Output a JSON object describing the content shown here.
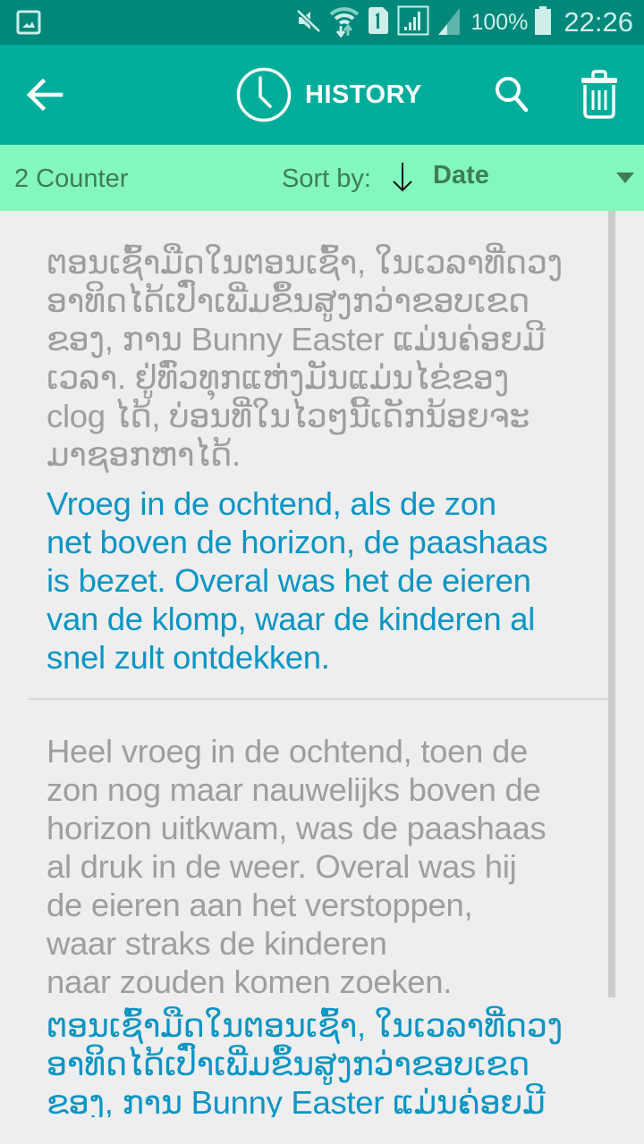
{
  "status_bar": {
    "left_icon": "gallery-notification-icon",
    "icons": [
      "mute-icon",
      "wifi-data-icon",
      "sim1-icon",
      "signal-sim1-icon",
      "signal-sim2-icon",
      "battery-icon"
    ],
    "battery_percent": "100%",
    "time": "22:26"
  },
  "app_bar": {
    "back_icon": "arrow-left-icon",
    "title_icon": "clock-icon",
    "title": "HISTORY",
    "search_icon": "search-icon",
    "delete_icon": "trash-icon",
    "background_color": "#00ad9b"
  },
  "sort_bar": {
    "counter": "2 Counter",
    "sort_label": "Sort by:",
    "sort_direction": "descending",
    "sort_value": "Date",
    "background_color": "#84f7be"
  },
  "history": [
    {
      "source_lines": [
        "ຕອນເຊົ້າມືດໃນຕອນເຊົ້າ, ໃນເວລາທີ່ດວງ",
        "ອາທິດໄດ້ເປົ່າເພີ່ມຂຶ້ນສູງກວ່າຂອບເຂດ",
        "ຂອງ, ການ Bunny Easter ແມ່ນຄ່ອຍມີ",
        "ເວລາ. ຢູ່ທົ່ວທຸກແຫ່ງມັນແມ່ນໄຂ່ຂອງ",
        "clog ໄດ້, ບ່ອນທີ່ໃນໄວໆນີ້ເດັກນ້ອຍຈະ",
        "ມາຊອກຫາໄດ້."
      ],
      "target_lines": [
        "Vroeg in de ochtend, als de zon",
        "net boven de horizon, de paashaas",
        "is bezet. Overal was het de eieren",
        "van de klomp, waar de kinderen al",
        "snel zult ontdekken."
      ]
    },
    {
      "source_lines": [
        "Heel vroeg in de ochtend, toen de",
        "zon nog maar nauwelijks boven de",
        "horizon uitkwam, was de paashaas",
        "al druk in de weer. Overal was hij",
        "de eieren aan het verstoppen,",
        "waar straks de kinderen",
        "naar zouden komen zoeken."
      ],
      "target_lines": [
        "ຕອນເຊົ້າມືດໃນຕອນເຊົ້າ, ໃນເວລາທີ່ດວງ",
        "ອາທິດໄດ້ເປົ່າເພີ່ມຂຶ້ນສູງກວ່າຂອບເຂດ",
        "ຂອງ, ການ Bunny Easter ແມ່ນຄ່ອຍມີ"
      ]
    }
  ],
  "colors": {
    "status_bar": "#00887a",
    "source_text": "#9e9e9e",
    "target_text": "#0a95c4",
    "sort_text": "#3f7c58"
  }
}
